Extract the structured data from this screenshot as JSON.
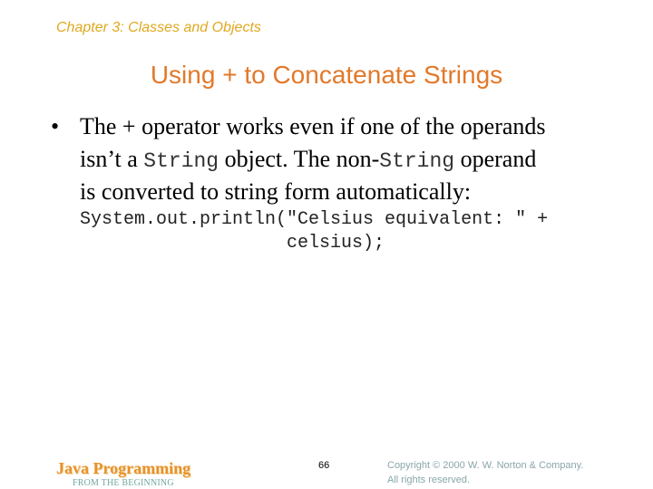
{
  "header": {
    "chapter": "Chapter 3: Classes and Objects"
  },
  "slide": {
    "title": "Using + to Concatenate Strings",
    "bullet_symbol": "•",
    "bullet": {
      "line1": "The + operator works even if one of the operands",
      "line2_a": "isn’t a ",
      "line2_code1": "String",
      "line2_b": " object. The non-",
      "line2_code2": "String",
      "line2_c": " operand",
      "line3": "is converted to string form automatically:"
    },
    "code": {
      "line1": "System.out.println(\"Celsius equivalent: \" +",
      "line2": "                   celsius);"
    }
  },
  "footer": {
    "logo_title": "Java Programming",
    "logo_subtitle": "FROM THE BEGINNING",
    "page_number": "66",
    "copyright_line1": "Copyright © 2000 W. W. Norton & Company.",
    "copyright_line2": "All rights reserved."
  },
  "colors": {
    "chapter": "#e0a820",
    "title": "#e2792a",
    "logo": "#e8922a",
    "logo_subtitle": "#6fa8a0",
    "copyright": "#8aa6a8"
  }
}
